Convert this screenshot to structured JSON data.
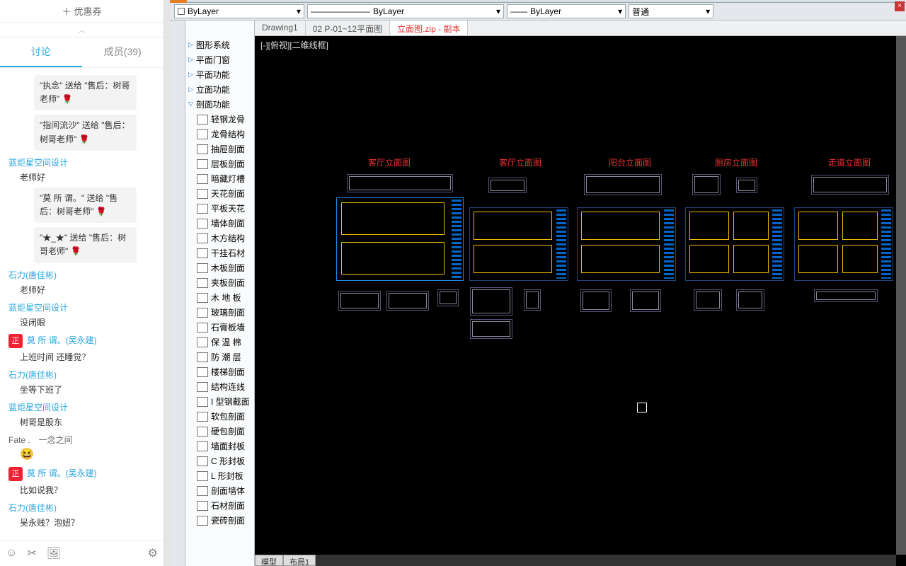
{
  "chat": {
    "coupon_label": "优惠券",
    "tabs": {
      "discuss": "讨论",
      "members": "成员(39)"
    },
    "messages": [
      {
        "type": "bubble",
        "text": "\"执念\" 送给 \"售后：树哥老师\" 🌹"
      },
      {
        "type": "bubble",
        "text": "\"指间流沙\" 送给 \"售后：树哥老师\" 🌹"
      },
      {
        "type": "usr",
        "user": "蓝炬星空间设计",
        "line": "老师好"
      },
      {
        "type": "bubble",
        "text": "\"莫 所 谓。\" 送给 \"售后：树哥老师\" 🌹"
      },
      {
        "type": "bubble",
        "text": "\"★_★\" 送给 \"售后：树哥老师\" 🌹"
      },
      {
        "type": "usr",
        "user": "石力(唐佳彬)",
        "line": "老师好"
      },
      {
        "type": "usr",
        "user": "蓝炬星空间设计",
        "line": "没闭眼"
      },
      {
        "type": "avatar",
        "badge": "正",
        "user": "莫 所 谓。(吴永建)",
        "line": "上班时间 还睡觉？"
      },
      {
        "type": "usr",
        "user": "石力(唐佳彬)",
        "line": "坐等下班了"
      },
      {
        "type": "usr",
        "user": "蓝炬星空间设计",
        "line": "树哥是股东"
      },
      {
        "type": "usr-alt",
        "user": "Fate .　一念之间",
        "emoji": "😆"
      },
      {
        "type": "avatar",
        "badge": "正",
        "user": "莫 所 谓。(吴永建)",
        "line": "比如说我？"
      },
      {
        "type": "usr",
        "user": "石力(唐佳彬)",
        "line": "吴永贱？泡妞？"
      }
    ]
  },
  "cad": {
    "layer_sel": "ByLayer",
    "linetype": "ByLayer",
    "lineweight": "ByLayer",
    "plot": "普通",
    "file_tabs": [
      {
        "label": "Drawing1"
      },
      {
        "label": "02  P-01~12平面图"
      },
      {
        "label": "立面图.zip - 副本",
        "red": true,
        "active": true
      }
    ],
    "canvas_label": "[-][俯视][二维线框]",
    "tree_top": [
      "图形系统",
      "平面门窗",
      "平面功能",
      "立面功能",
      "剖面功能"
    ],
    "tree_items": [
      "轻钢龙骨<lg>",
      "龙骨结构<lgg",
      "抽屉剖面<ct>",
      "层板剖面<cb>",
      "暗藏灯槽<edc",
      "天花剖面<thp",
      "平板天花<pb>",
      "墙体剖面<pm>",
      "木方结构<mf>",
      "干挂石材<ggs",
      "木板剖面<mb>",
      "夹板剖面<jbb",
      "木 地 板<mdb",
      "玻璃剖面<bll",
      "石膏板墙<sgb",
      "保 温 棉<bwm",
      "防 潮 层<fcc",
      "楼梯剖面<ltt",
      "结构连线<jg>",
      "I 型钢截面<ggg",
      "软包剖面<rbm",
      "硬包剖面<ybm",
      "墙面封板<fb>",
      "C 形封板<cfb",
      "L 形封板<fb>",
      "剖面墙体<qt>",
      "石材剖面<sm>",
      "瓷砖剖面<zpm"
    ],
    "dwg_titles": [
      "客厅立面图",
      "客厅立面图",
      "阳台立面图",
      "厨房立面图",
      "走道立面图"
    ],
    "bottom_tab1": "模型",
    "bottom_tab2": "布局1"
  }
}
